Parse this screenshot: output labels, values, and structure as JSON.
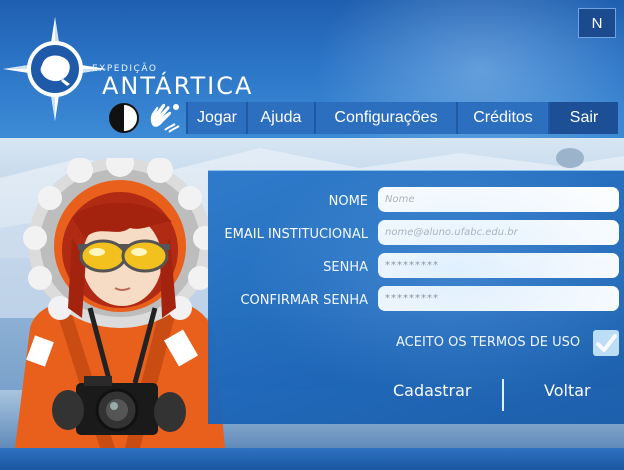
{
  "logo": {
    "subtitle": "EXPEDIÇÃO",
    "title": "ANTÁRTICA"
  },
  "top_right": {
    "label": "N"
  },
  "menu": {
    "items": [
      {
        "label": "Jogar"
      },
      {
        "label": "Ajuda"
      },
      {
        "label": "Configurações"
      },
      {
        "label": "Créditos"
      },
      {
        "label": "Sair"
      }
    ]
  },
  "accessibility": {
    "contrast_icon": "contrast-icon",
    "sign_language_icon": "sign-language-icon"
  },
  "form": {
    "name_label": "NOME",
    "name_placeholder": "Nome",
    "email_label": "EMAIL INSTITUCIONAL",
    "email_placeholder": "nome@aluno.ufabc.edu.br",
    "password_label": "SENHA",
    "password_placeholder": "*********",
    "confirm_label": "CONFIRMAR SENHA",
    "confirm_placeholder": "*********",
    "terms_label": "ACEITO OS TERMOS DE USO",
    "terms_checked": true,
    "register_label": "Cadastrar",
    "back_label": "Voltar"
  },
  "colors": {
    "header": "#2b74c6",
    "panel": "#1d66b8",
    "parka": "#e8601c"
  }
}
